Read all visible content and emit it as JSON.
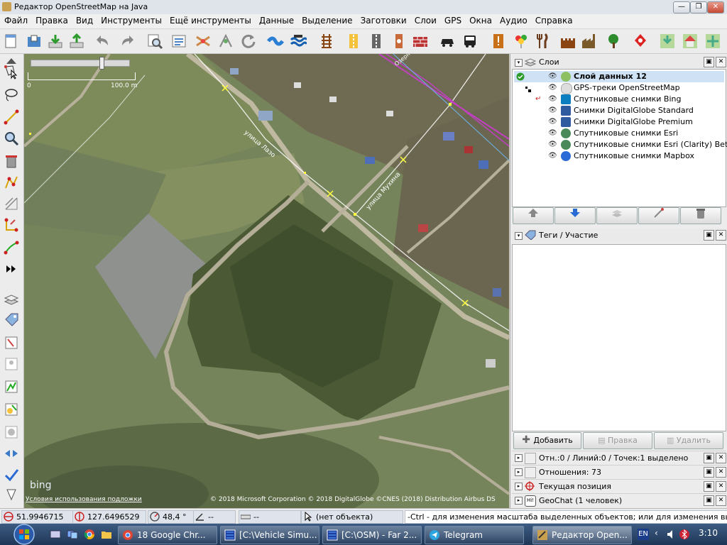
{
  "window": {
    "title": "Редактор OpenStreetMap на Java",
    "buttons": {
      "minimize": "—",
      "maximize": "❐",
      "close": "✕"
    }
  },
  "menu": [
    "Файл",
    "Правка",
    "Вид",
    "Инструменты",
    "Ещё инструменты",
    "Данные",
    "Выделение",
    "Заготовки",
    "Слои",
    "GPS",
    "Окна",
    "Аудио",
    "Справка"
  ],
  "map": {
    "scale_start": "0",
    "scale_end": "100.0 m",
    "street_labels": [
      "улица Лазо",
      "улица Мухина",
      "Озерное"
    ],
    "bing_logo": "bing",
    "terms_link": "Условия использования подложки",
    "attribution": "© 2018 Microsoft Corporation © 2018 DigitalGlobe ©CNES (2018) Distribution Airbus DS"
  },
  "layers_panel": {
    "title": "Слои",
    "layers": [
      {
        "name": "Слой данных 12",
        "active": true,
        "color": "#8cc060"
      },
      {
        "name": "GPS-треки OpenStreetMap",
        "active": false,
        "color": "#dddddd"
      },
      {
        "name": "Спутниковые снимки Bing",
        "active": false,
        "color": "#0a7ebf"
      },
      {
        "name": "Снимки DigitalGlobe Standard",
        "active": false,
        "color": "#2f5aa0"
      },
      {
        "name": "Снимки DigitalGlobe Premium",
        "active": false,
        "color": "#2f5aa0"
      },
      {
        "name": "Спутниковые снимки Esri",
        "active": false,
        "color": "#4a8a5a"
      },
      {
        "name": "Спутниковые снимки Esri (Clarity) Beta",
        "active": false,
        "color": "#4a8a5a"
      },
      {
        "name": "Спутниковые снимки Mapbox",
        "active": false,
        "color": "#2a6bd8"
      }
    ]
  },
  "tags_panel": {
    "title": "Теги / Участие",
    "add_label": "Добавить",
    "edit_label": "Правка",
    "delete_label": "Удалить"
  },
  "mini_panels": [
    {
      "label": "Отн.:0 / Линий:0 / Точек:1 выделено"
    },
    {
      "label": "Отношения: 73"
    },
    {
      "label": "Текущая позиция"
    },
    {
      "label": "GeoChat (1 человек)"
    }
  ],
  "status": {
    "lat": "51.9946715",
    "lon": "127.6496529",
    "heading": "48,4 °",
    "angle": "--",
    "distance": "--",
    "object": "(нет объекта)",
    "hint": "-Ctrl - для изменения масштаба выделенных объектов; или для изменения выделения"
  },
  "taskbar": {
    "items": [
      {
        "label": "18  Google Chr...",
        "active": false
      },
      {
        "label": "[C:\\Vehicle Simu...",
        "active": false
      },
      {
        "label": "[C:\\OSM) - Far 2...",
        "active": false
      },
      {
        "label": "Telegram",
        "active": false
      },
      {
        "label": "Редактор Open...",
        "active": true
      }
    ],
    "lang": "EN",
    "clock": "3:10"
  }
}
